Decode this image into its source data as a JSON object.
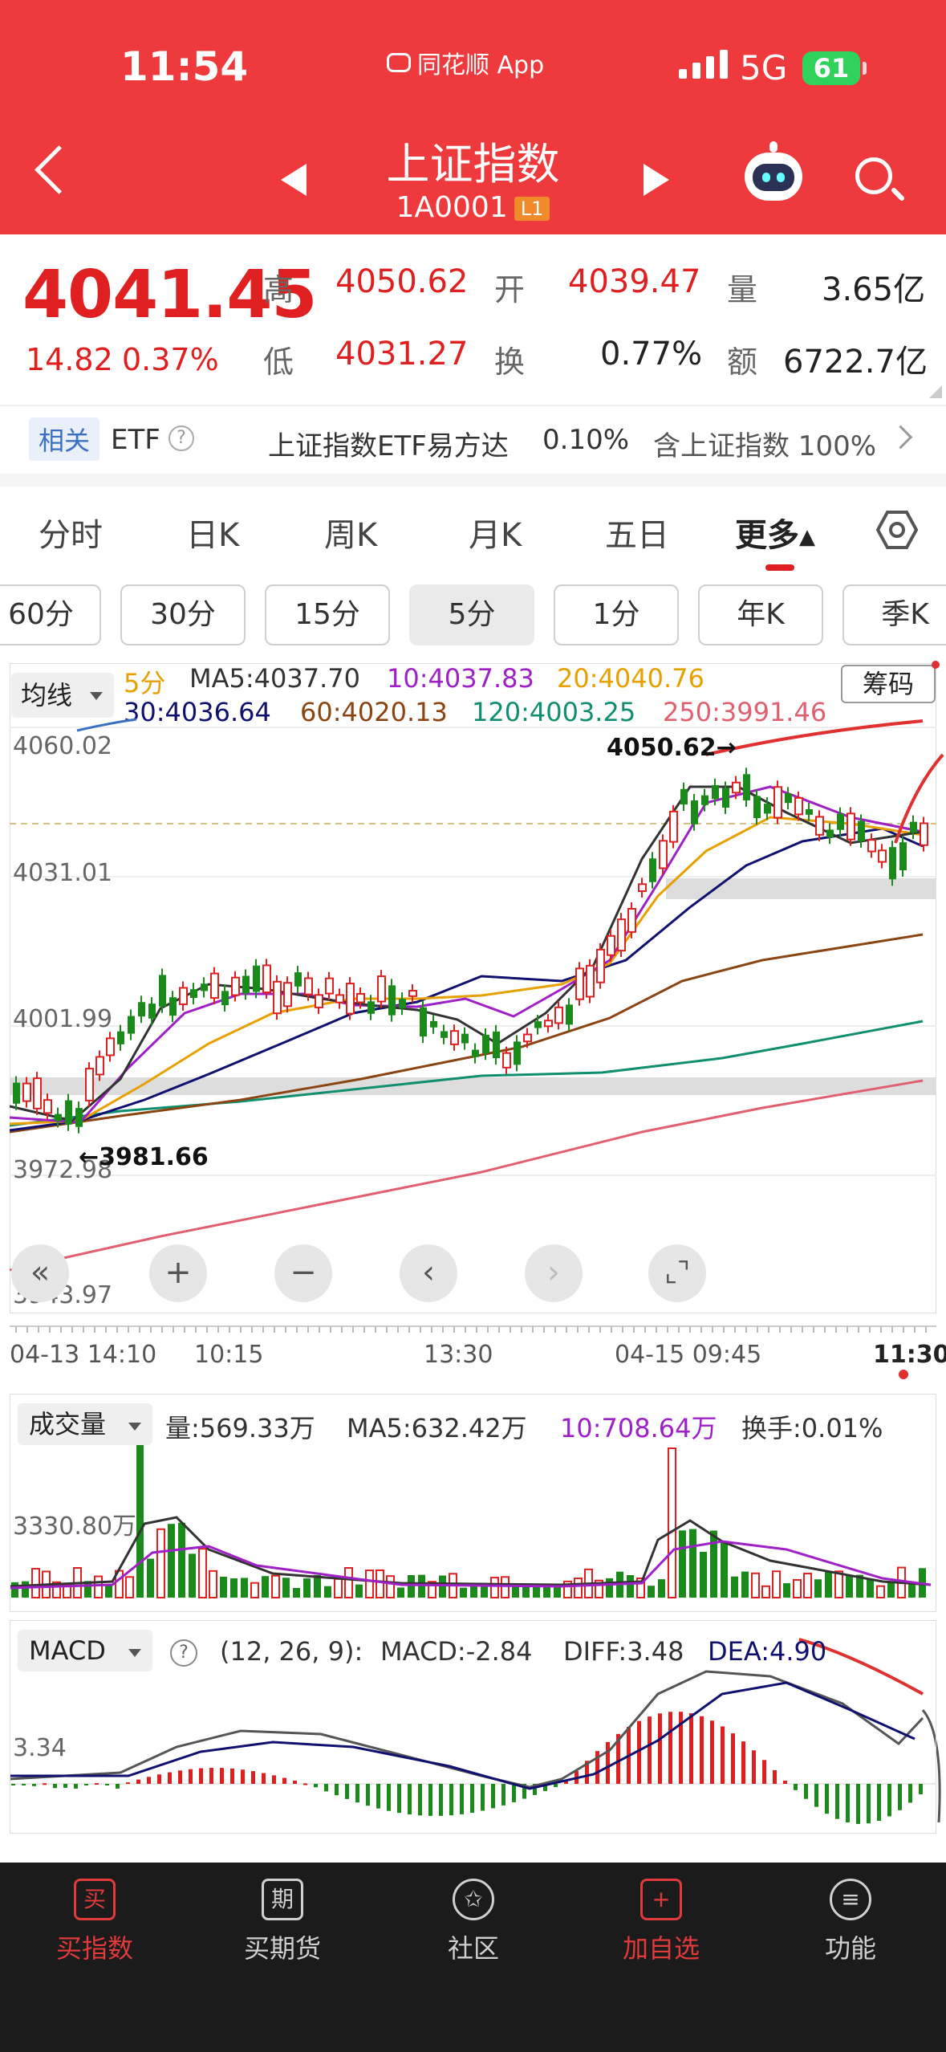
{
  "status_bar": {
    "time": "11:54",
    "app": "同花顺 App",
    "network": "5G",
    "battery": "61"
  },
  "header": {
    "title": "上证指数",
    "code": "1A0001",
    "level": "L1"
  },
  "quote": {
    "price": "4041.45",
    "change": "14.82",
    "change_pct": "0.37%",
    "high_label": "高",
    "high": "4050.62",
    "low_label": "低",
    "low": "4031.27",
    "open_label": "开",
    "open": "4039.47",
    "turnover_label": "换",
    "turnover": "0.77%",
    "volume_label": "量",
    "volume": "3.65亿",
    "amount_label": "额",
    "amount": "6722.7亿"
  },
  "etf": {
    "tag": "相关",
    "label": "ETF",
    "fund_name": "上证指数ETF易方达",
    "fund_change": "0.10%",
    "holding": "含上证指数 100%"
  },
  "tabs": [
    {
      "label": "分时"
    },
    {
      "label": "日K"
    },
    {
      "label": "周K"
    },
    {
      "label": "月K"
    },
    {
      "label": "五日"
    },
    {
      "label": "更多"
    }
  ],
  "periods": [
    {
      "label": "60分"
    },
    {
      "label": "30分"
    },
    {
      "label": "15分"
    },
    {
      "label": "5分"
    },
    {
      "label": "1分"
    },
    {
      "label": "年K"
    },
    {
      "label": "季K"
    }
  ],
  "indicator": {
    "selector": "均线",
    "chips": "筹码",
    "period": "5分",
    "ma5": "MA5:4037.70",
    "ma10": "10:4037.83",
    "ma20": "20:4040.76",
    "ma30": "30:4036.64",
    "ma60": "60:4020.13",
    "ma120": "120:4003.25",
    "ma250": "250:3991.46"
  },
  "y_axis": [
    "4060.02",
    "4031.01",
    "4001.99",
    "3972.98",
    "3943.97"
  ],
  "annotations": {
    "high": "4050.62→",
    "low": "←3981.66"
  },
  "time_axis": [
    "04-13 14:10",
    "10:15",
    "13:30",
    "04-15 09:45",
    "11:30"
  ],
  "volume": {
    "selector": "成交量",
    "vol": "量:569.33万",
    "ma5": "MA5:632.42万",
    "ma10": "10:708.64万",
    "turnover": "换手:0.01%",
    "axis": "3330.80万"
  },
  "macd": {
    "selector": "MACD",
    "params": "(12, 26, 9):",
    "macd": "MACD:-2.84",
    "diff": "DIFF:3.48",
    "dea": "DEA:4.90",
    "axis": "3.34"
  },
  "colors": {
    "header": "#ee3a3c",
    "up": "#e02020",
    "down": "#1a8a1a",
    "ma5": "#222222",
    "ma10": "#a020c8",
    "ma20": "#e8a000",
    "ma30": "#101070",
    "ma60": "#8b4513",
    "ma120": "#0f8f6f",
    "ma250": "#e06070"
  },
  "bottom_nav": [
    {
      "label": "买指数",
      "icon": "买"
    },
    {
      "label": "买期货",
      "icon": "期"
    },
    {
      "label": "社区",
      "icon": "✩"
    },
    {
      "label": "加自选",
      "icon": "+"
    },
    {
      "label": "功能",
      "icon": "≡"
    }
  ]
}
